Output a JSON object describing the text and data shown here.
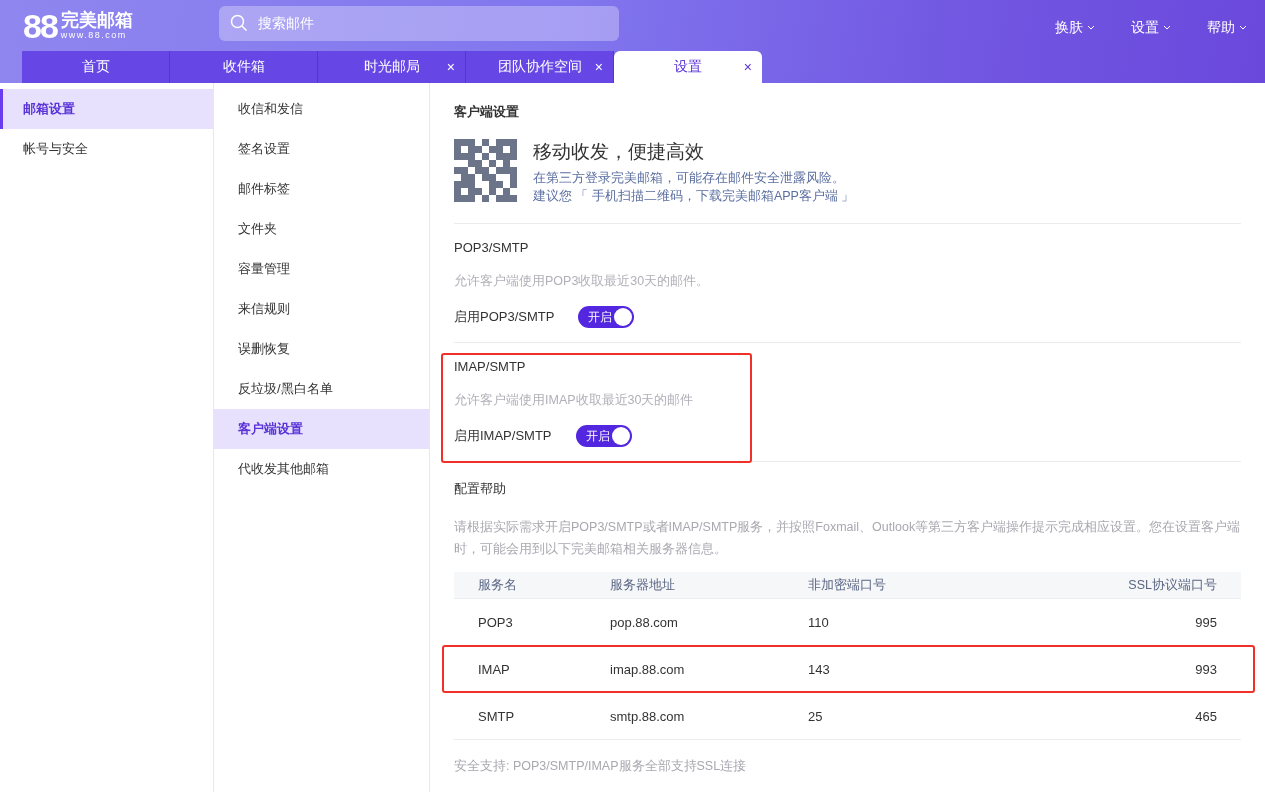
{
  "logo": {
    "mark": "88",
    "name": "完美邮箱",
    "url": "www.88.com"
  },
  "search": {
    "placeholder": "搜索邮件"
  },
  "top_menu": [
    {
      "label": "换肤"
    },
    {
      "label": "设置"
    },
    {
      "label": "帮助"
    }
  ],
  "tabs": [
    {
      "label": "首页",
      "selected": false,
      "closable": false
    },
    {
      "label": "收件箱",
      "selected": false,
      "closable": false
    },
    {
      "label": "时光邮局",
      "selected": false,
      "closable": true
    },
    {
      "label": "团队协作空间",
      "selected": false,
      "closable": true
    },
    {
      "label": "设置",
      "selected": true,
      "closable": true
    }
  ],
  "close_glyph": "×",
  "sidebar": {
    "items": [
      {
        "label": "邮箱设置",
        "selected": true
      },
      {
        "label": "帐号与安全",
        "selected": false
      }
    ]
  },
  "subnav": {
    "items": [
      {
        "label": "收信和发信",
        "selected": false
      },
      {
        "label": "签名设置",
        "selected": false
      },
      {
        "label": "邮件标签",
        "selected": false
      },
      {
        "label": "文件夹",
        "selected": false
      },
      {
        "label": "容量管理",
        "selected": false
      },
      {
        "label": "来信规则",
        "selected": false
      },
      {
        "label": "误删恢复",
        "selected": false
      },
      {
        "label": "反垃圾/黑白名单",
        "selected": false
      },
      {
        "label": "客户端设置",
        "selected": true
      },
      {
        "label": "代收发其他邮箱",
        "selected": false
      }
    ]
  },
  "content": {
    "title": "客户端设置",
    "promo": {
      "headline": "移动收发，便捷高效",
      "lines": [
        "在第三方登录完美邮箱，可能存在邮件安全泄露风险。",
        "建议您 「 手机扫描二维码，下载完美邮箱APP客户端 」"
      ]
    },
    "sections": [
      {
        "title": "POP3/SMTP",
        "description": "允许客户端使用POP3收取最近30天的邮件。",
        "toggle_label": "启用POP3/SMTP",
        "toggle_text": "开启",
        "on": true,
        "highlighted": false
      },
      {
        "title": "IMAP/SMTP",
        "description": "允许客户端使用IMAP收取最近30天的邮件",
        "toggle_label": "启用IMAP/SMTP",
        "toggle_text": "开启",
        "on": true,
        "highlighted": true
      }
    ],
    "help": {
      "title": "配置帮助",
      "text": "请根据实际需求开启POP3/SMTP或者IMAP/SMTP服务，并按照Foxmail、Outlook等第三方客户端操作提示完成相应设置。您在设置客户端时，可能会用到以下完美邮箱相关服务器信息。"
    },
    "table": {
      "columns": [
        "服务名",
        "服务器地址",
        "非加密端口号",
        "SSL协议端口号"
      ],
      "rows": [
        {
          "cells": [
            "POP3",
            "pop.88.com",
            "110",
            "995"
          ],
          "highlighted": false
        },
        {
          "cells": [
            "IMAP",
            "imap.88.com",
            "143",
            "993"
          ],
          "highlighted": true
        },
        {
          "cells": [
            "SMTP",
            "smtp.88.com",
            "25",
            "465"
          ],
          "highlighted": false
        }
      ]
    },
    "footer": "安全支持: POP3/SMTP/IMAP服务全部支持SSL连接"
  }
}
